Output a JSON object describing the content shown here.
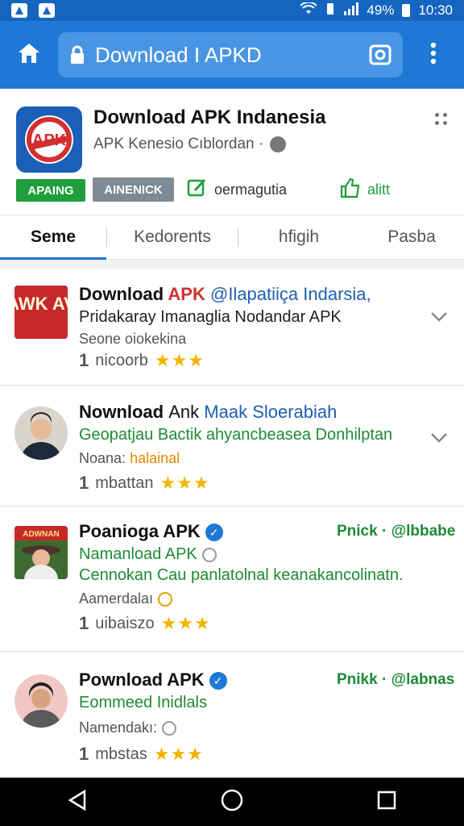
{
  "status_bar": {
    "battery": "49%",
    "time": "10:30"
  },
  "browser": {
    "url_text": "Download I APKD"
  },
  "app_header": {
    "title": "Download APK Indanesia",
    "subtitle": "APK Kenesio Cıblordan ·",
    "chip_green": "APAING",
    "chip_grey": "AINENICK",
    "action_left": "oermagutia",
    "action_right": "alitt"
  },
  "tabs": [
    {
      "label": "Seme",
      "active": true
    },
    {
      "label": "Kedorents",
      "active": false
    },
    {
      "label": "hfigih",
      "active": false
    },
    {
      "label": "Pasba",
      "active": false
    }
  ],
  "items": [
    {
      "thumb_text": "AWK AV",
      "title_a": "Download",
      "title_b": "APK",
      "title_c": "@Ilapatiiça Indarsia,",
      "line2": "Pridakaray Imanaglia Nodandar APK",
      "line3": "Seone oiokekina",
      "rating_num": "1",
      "rating_label": "nicoorb",
      "stars": "★★★"
    },
    {
      "title_a": "Nownload",
      "title_b": "Ank",
      "title_c": "Maak Sloerabiah",
      "line2_a": "Geopatjau Bactik ahyancbeasea",
      "line2_b": "Donhilptan",
      "line3_a": "Noana:",
      "line3_b": "halainal",
      "rating_num": "1",
      "rating_label": "mbattan",
      "stars": "★★★"
    },
    {
      "thumb_text": "ADWNAN",
      "title": "Poanioga APK",
      "side_label": "Pnick · @lbbabe",
      "line2": "Namanload APK",
      "line3": "Cennokan Cau panlatolnal keanakancolinatn.",
      "line4": "Aamerdalaı",
      "rating_num": "1",
      "rating_label": "uibaiszo",
      "stars": "★★★"
    },
    {
      "title": "Pownload APK",
      "side_label": "Pnikk · @labnas",
      "line2": "Eommeed Inidlals",
      "line3": "Namendakı:",
      "rating_num": "1",
      "rating_label": "mbstas",
      "stars": "★★★"
    }
  ]
}
